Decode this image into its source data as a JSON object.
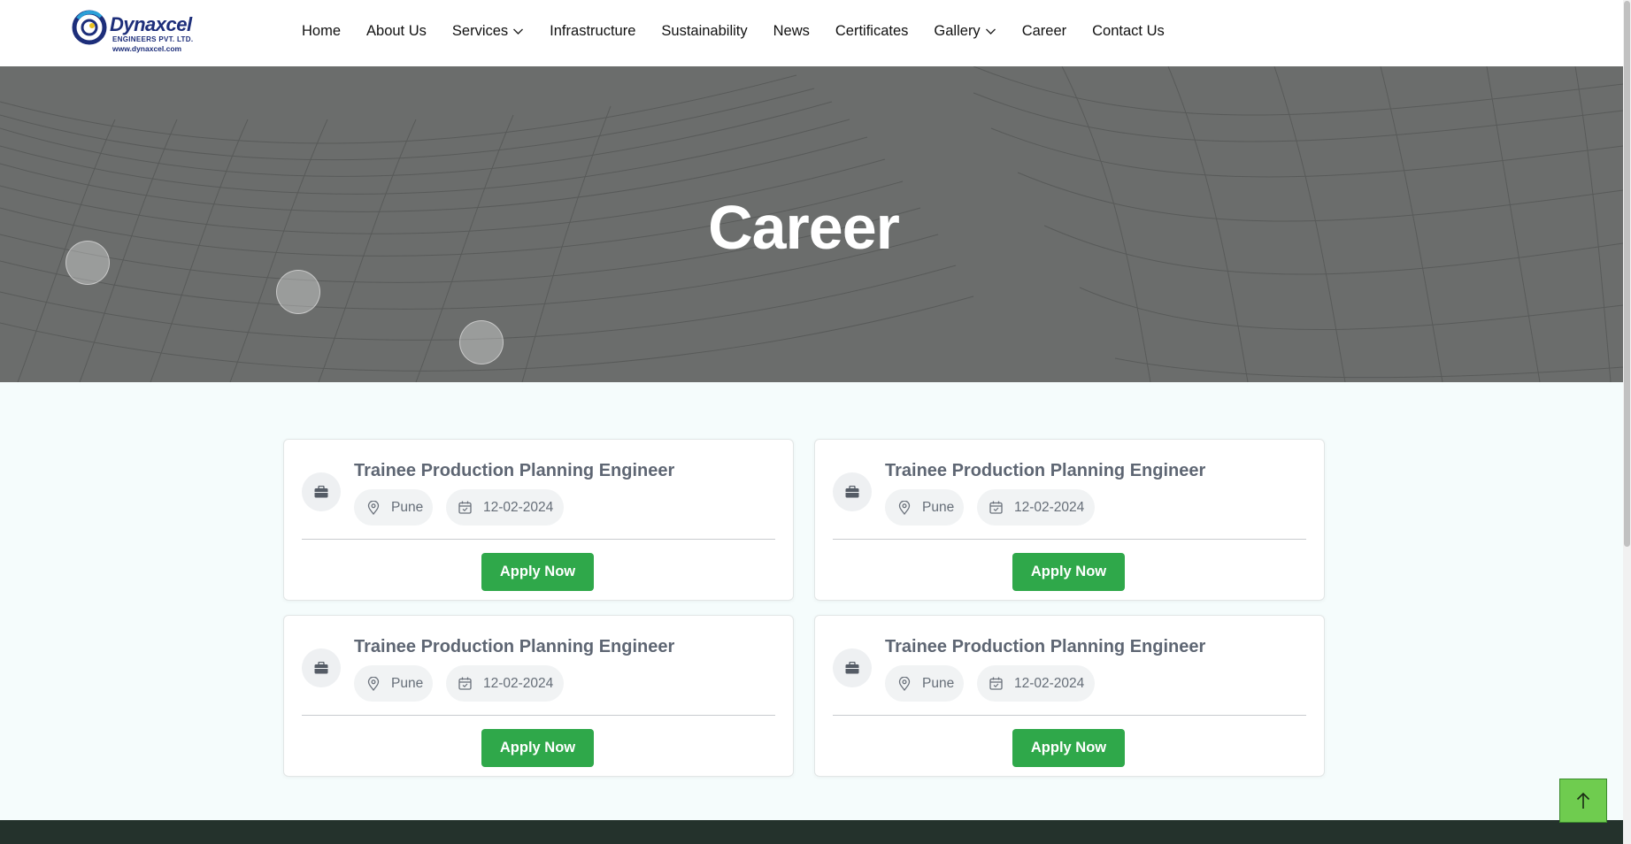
{
  "header": {
    "logo": {
      "name": "Dynaxcel",
      "subtitle": "ENGINEERS PVT. LTD.",
      "url": "www.dynaxcel.com"
    },
    "nav": [
      {
        "label": "Home",
        "dropdown": false
      },
      {
        "label": "About Us",
        "dropdown": false
      },
      {
        "label": "Services",
        "dropdown": true
      },
      {
        "label": "Infrastructure",
        "dropdown": false
      },
      {
        "label": "Sustainability",
        "dropdown": false
      },
      {
        "label": "News",
        "dropdown": false
      },
      {
        "label": "Certificates",
        "dropdown": false
      },
      {
        "label": "Gallery",
        "dropdown": true
      },
      {
        "label": "Career",
        "dropdown": false
      },
      {
        "label": "Contact Us",
        "dropdown": false
      }
    ]
  },
  "hero": {
    "title": "Career"
  },
  "jobs": [
    {
      "title": "Trainee Production Planning Engineer",
      "location": "Pune",
      "date": "12-02-2024",
      "button": "Apply Now"
    },
    {
      "title": "Trainee Production Planning Engineer",
      "location": "Pune",
      "date": "12-02-2024",
      "button": "Apply Now"
    },
    {
      "title": "Trainee Production Planning Engineer",
      "location": "Pune",
      "date": "12-02-2024",
      "button": "Apply Now"
    },
    {
      "title": "Trainee Production Planning Engineer",
      "location": "Pune",
      "date": "12-02-2024",
      "button": "Apply Now"
    }
  ],
  "icons": {
    "job": "briefcase-icon",
    "location": "map-pin-icon",
    "date": "calendar-icon",
    "back_to_top": "arrow-up-icon"
  },
  "colors": {
    "brand": "#1d2e7a",
    "apply_button": "#2fa84a",
    "back_to_top": "#6fcc4f",
    "hero_bg": "#6b6d6c",
    "footer": "#24322c"
  }
}
